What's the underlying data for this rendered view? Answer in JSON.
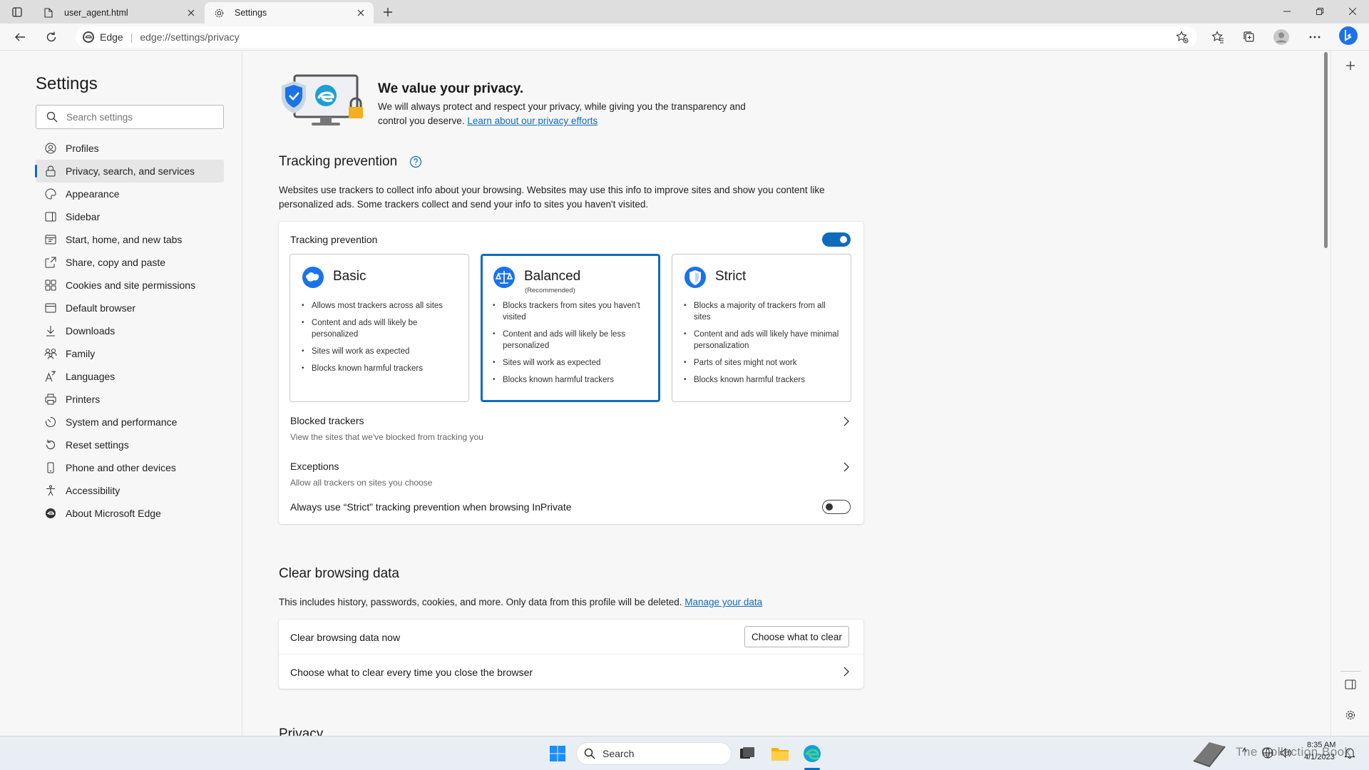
{
  "browser": {
    "tabs": [
      {
        "title": "user_agent.html",
        "active": false
      },
      {
        "title": "Settings",
        "active": true
      }
    ],
    "site_label": "Edge",
    "url": "edge://settings/privacy"
  },
  "nav": {
    "title": "Settings",
    "search_placeholder": "Search settings",
    "items": [
      {
        "label": "Profiles",
        "icon": "profile-icon"
      },
      {
        "label": "Privacy, search, and services",
        "icon": "lock-icon",
        "active": true
      },
      {
        "label": "Appearance",
        "icon": "appearance-icon"
      },
      {
        "label": "Sidebar",
        "icon": "sidebar-icon"
      },
      {
        "label": "Start, home, and new tabs",
        "icon": "home-icon"
      },
      {
        "label": "Share, copy and paste",
        "icon": "share-icon"
      },
      {
        "label": "Cookies and site permissions",
        "icon": "permissions-icon"
      },
      {
        "label": "Default browser",
        "icon": "browser-icon"
      },
      {
        "label": "Downloads",
        "icon": "download-icon"
      },
      {
        "label": "Family",
        "icon": "family-icon"
      },
      {
        "label": "Languages",
        "icon": "languages-icon"
      },
      {
        "label": "Printers",
        "icon": "printer-icon"
      },
      {
        "label": "System and performance",
        "icon": "system-icon"
      },
      {
        "label": "Reset settings",
        "icon": "reset-icon"
      },
      {
        "label": "Phone and other devices",
        "icon": "phone-icon"
      },
      {
        "label": "Accessibility",
        "icon": "accessibility-icon"
      },
      {
        "label": "About Microsoft Edge",
        "icon": "edge-logo-icon"
      }
    ]
  },
  "hero": {
    "title": "We value your privacy.",
    "body": "We will always protect and respect your privacy, while giving you the transparency and control you deserve.",
    "link": "Learn about our privacy efforts"
  },
  "tracking": {
    "title": "Tracking prevention",
    "description": "Websites use trackers to collect info about your browsing. Websites may use this info to improve sites and show you content like personalized ads. Some trackers collect and send your info to sites you haven't visited.",
    "card_title": "Tracking prevention",
    "enabled": true,
    "options": [
      {
        "name": "Basic",
        "recommended": "",
        "selected": false,
        "bullets": [
          "Allows most trackers across all sites",
          "Content and ads will likely be personalized",
          "Sites will work as expected",
          "Blocks known harmful trackers"
        ]
      },
      {
        "name": "Balanced",
        "recommended": "(Recommended)",
        "selected": true,
        "bullets": [
          "Blocks trackers from sites you haven't visited",
          "Content and ads will likely be less personalized",
          "Sites will work as expected",
          "Blocks known harmful trackers"
        ]
      },
      {
        "name": "Strict",
        "recommended": "",
        "selected": false,
        "bullets": [
          "Blocks a majority of trackers from all sites",
          "Content and ads will likely have minimal personalization",
          "Parts of sites might not work",
          "Blocks known harmful trackers"
        ]
      }
    ],
    "blocked_title": "Blocked trackers",
    "blocked_sub": "View the sites that we've blocked from tracking you",
    "exceptions_title": "Exceptions",
    "exceptions_sub": "Allow all trackers on sites you choose",
    "strict_inprivate": "Always use “Strict” tracking prevention when browsing InPrivate",
    "strict_inprivate_enabled": false
  },
  "clear": {
    "title": "Clear browsing data",
    "description": "This includes history, passwords, cookies, and more. Only data from this profile will be deleted.",
    "link": "Manage your data",
    "row1": "Clear browsing data now",
    "row1_button": "Choose what to clear",
    "row2": "Choose what to clear every time you close the browser"
  },
  "next_section": "Privacy",
  "taskbar": {
    "search_label": "Search",
    "time": "8:35 AM",
    "date": "4/1/2023",
    "watermark": "The Collection Book"
  },
  "colors": {
    "accent": "#0f6cbd",
    "background": "#f7f7f7",
    "card": "#ffffff"
  }
}
